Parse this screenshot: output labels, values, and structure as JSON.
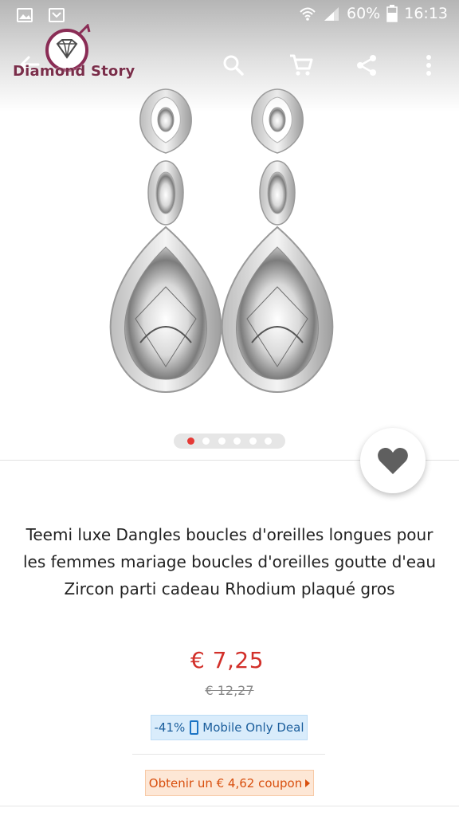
{
  "status_bar": {
    "battery": "60%",
    "time": "16:13",
    "icons": [
      "image-icon",
      "notification-icon",
      "wifi-icon",
      "signal-icon",
      "battery-icon"
    ]
  },
  "toolbar": {
    "brand": "Diamond Story",
    "icons": [
      "back-arrow-icon",
      "search-icon",
      "cart-icon",
      "share-icon",
      "more-vert-icon"
    ]
  },
  "gallery": {
    "image_count": 6,
    "active_index": 0
  },
  "product": {
    "title": "Teemi luxe Dangles boucles d'oreilles longues pour les femmes mariage boucles d'oreilles goutte d'eau Zircon parti cadeau Rhodium plaqué gros",
    "price": "€ 7,25",
    "old_price": "€ 12,27",
    "discount": "-41%",
    "deal_label": "Mobile Only Deal",
    "coupon_label": "Obtenir un € 4,62 coupon"
  },
  "colors": {
    "price": "#d2302a",
    "deal_text": "#1b5e9c",
    "deal_bg": "#d9ecfb",
    "coupon_text": "#d84f0e",
    "coupon_bg": "#fde7d6",
    "active_dot": "#e53935",
    "brand": "#7a2e4a"
  }
}
